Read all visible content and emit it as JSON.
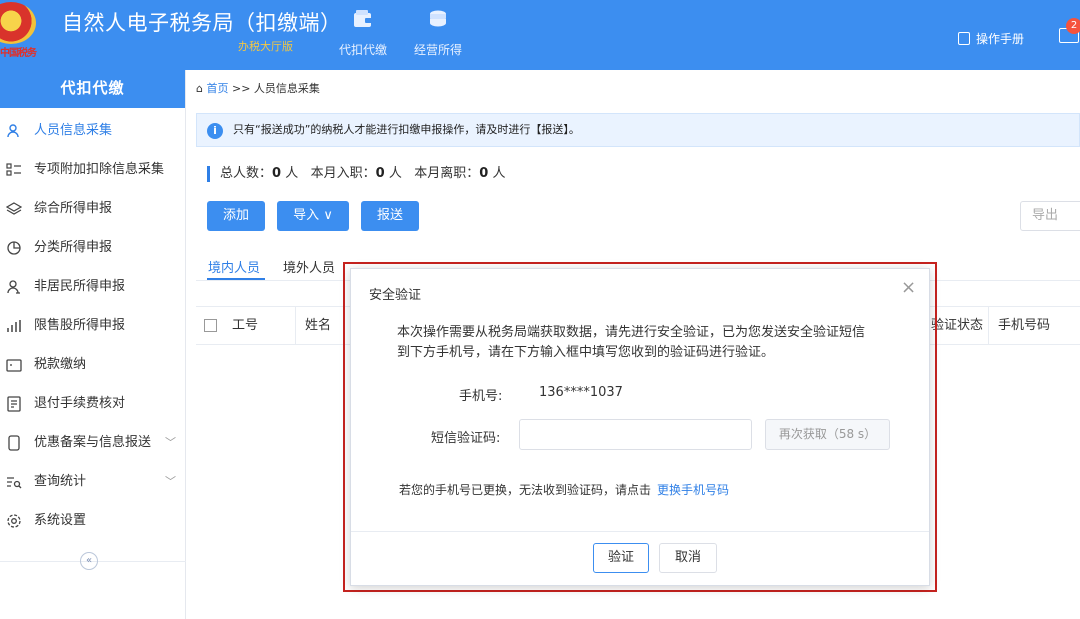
{
  "header": {
    "emblem_text": "中国税务",
    "title": "自然人电子税务局（扣缴端）",
    "subtitle": "办税大厅版",
    "nav": [
      {
        "label": "代扣代缴",
        "icon": "wallet-icon"
      },
      {
        "label": "经营所得",
        "icon": "coins-icon"
      }
    ],
    "manual_label": "操作手册",
    "mail_badge": "2"
  },
  "sidebar": {
    "title": "代扣代缴",
    "items": [
      {
        "label": "人员信息采集",
        "icon": "person-icon",
        "active": true
      },
      {
        "label": "专项附加扣除信息采集",
        "icon": "list-icon"
      },
      {
        "label": "综合所得申报",
        "icon": "layers-icon"
      },
      {
        "label": "分类所得申报",
        "icon": "pie-chart-icon"
      },
      {
        "label": "非居民所得申报",
        "icon": "person-outline-icon"
      },
      {
        "label": "限售股所得申报",
        "icon": "bar-chart-icon"
      },
      {
        "label": "税款缴纳",
        "icon": "wallet-outline-icon"
      },
      {
        "label": "退付手续费核对",
        "icon": "document-icon"
      },
      {
        "label": "优惠备案与信息报送",
        "icon": "file-icon",
        "has_children": true
      },
      {
        "label": "查询统计",
        "icon": "search-list-icon",
        "has_children": true
      },
      {
        "label": "系统设置",
        "icon": "settings-icon"
      }
    ],
    "collapse_symbol": "«"
  },
  "breadcrumb": {
    "home": "首页",
    "separator": ">>",
    "current": "人员信息采集"
  },
  "alert": {
    "icon": "i",
    "text": "只有“报送成功”的纳税人才能进行扣缴申报操作，请及时进行【报送】。"
  },
  "stats": {
    "total_label": "总人数：",
    "total": "0",
    "unit1": "人",
    "joined_label": "本月入职：",
    "joined": "0",
    "unit2": "人",
    "left_label": "本月离职：",
    "left": "0",
    "unit3": "人"
  },
  "toolbar": {
    "add": "添加",
    "import": "导入",
    "send": "报送",
    "export": "导出"
  },
  "tabs": [
    "境内人员",
    "境外人员"
  ],
  "table": {
    "columns": [
      "工号",
      "姓名",
      "验证状态",
      "手机号码"
    ]
  },
  "modal": {
    "title": "安全验证",
    "message": "本次操作需要从税务局端获取数据，请先进行安全验证，已为您发送安全验证短信到下方手机号，请在下方输入框中填写您收到的验证码进行验证。",
    "phone_label": "手机号:",
    "phone_value": "136****1037",
    "code_label": "短信验证码:",
    "code_value": "",
    "resend_label": "再次获取（58 s）",
    "change_note": "若您的手机号已更换，无法收到验证码，请点击",
    "change_link": "更换手机号码",
    "verify": "验证",
    "cancel": "取消"
  }
}
